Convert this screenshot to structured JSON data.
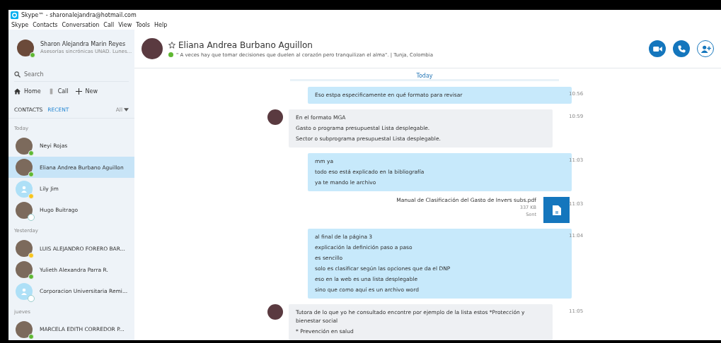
{
  "window": {
    "title": "Skype™ - sharonalejandra@hotmail.com"
  },
  "menu": [
    "Skype",
    "Contacts",
    "Conversation",
    "Call",
    "View",
    "Tools",
    "Help"
  ],
  "profile": {
    "name": "Sharon Alejandra Marin Reyes",
    "mood": "Asesorías sincrónicas UNAD. Lunes...",
    "color": "#5fb832"
  },
  "search": {
    "placeholder": "Search"
  },
  "nav": [
    {
      "label": "Home",
      "kind": "home"
    },
    {
      "label": "Call",
      "kind": "call"
    },
    {
      "label": "New",
      "kind": "new"
    }
  ],
  "list_tabs": [
    {
      "label": "CONTACTS",
      "selected": false
    },
    {
      "label": "RECENT",
      "selected": true
    }
  ],
  "filter": "All",
  "groups": [
    {
      "label": "Today",
      "contacts": [
        {
          "name": "Neyi Rojas",
          "color": "#5fb832",
          "selected": false,
          "photo": true
        },
        {
          "name": "Eliana Andrea Burbano Aguillon",
          "color": "#5fb832",
          "selected": true,
          "photo": true
        },
        {
          "name": "Lily Jim",
          "color": "#f8c51c",
          "selected": false,
          "photo": false
        },
        {
          "name": "Hugo Buitrago",
          "color": "#ffffff",
          "selected": false,
          "photo": true
        }
      ]
    },
    {
      "label": "Yesterday",
      "contacts": [
        {
          "name": "LUIS ALEJANDRO FORERO BAR...",
          "color": "#f8c51c",
          "selected": false,
          "photo": true
        },
        {
          "name": "Yulieth Alexandra Parra R.",
          "color": "#5fb832",
          "selected": false,
          "photo": true
        },
        {
          "name": "Corporacion Universitaria Remi...",
          "color": "#ffffff",
          "selected": false,
          "photo": false
        }
      ]
    },
    {
      "label": "jueves",
      "contacts": [
        {
          "name": "MARCELA EDITH CORREDOR P...",
          "color": "#5fb832",
          "selected": false,
          "photo": true
        }
      ]
    }
  ],
  "conversation": {
    "name": "Eliana Andrea Burbano Aguillon",
    "favorite": false,
    "color": "#5fb832",
    "mood": "\" A veces hay que tomar decisiones que duelen al corazón pero tranquilizan el alma\". | Tunja, Colombia"
  },
  "day_separator": "Today",
  "messages": [
    {
      "kind": "sent",
      "lines": [
        "Eso estpa especificamente en qué formato para revisar"
      ],
      "time": "10:56"
    },
    {
      "kind": "received",
      "lines": [
        "En el formato MGA",
        "Gasto o programa presupuestal Lista desplegable.",
        "Sector o subprograma presupuestal Lista desplegable."
      ],
      "time": "10:59"
    },
    {
      "kind": "sent",
      "lines": [
        "mm ya",
        "todo eso está explicado en la bibliografía",
        "ya te mando le archivo"
      ],
      "time": "11:03"
    },
    {
      "kind": "file",
      "lines": [
        "Manual de Clasificación del Gasto de Invers subs.pdf",
        "337 KB",
        "Sent"
      ],
      "time": "11:03"
    },
    {
      "kind": "sent",
      "lines": [
        "al final de la página 3",
        "explicación la definición paso a paso",
        "es sencillo",
        "solo es clasificar según las opciones que da el DNP",
        "eso en la web es una lista desplegable",
        "sino que como aquí es un archivo word"
      ],
      "time": "11:04"
    },
    {
      "kind": "received",
      "lines": [
        "Tutora de lo que yo he consultado encontre por ejemplo de la lista estos *Protección y bienestar social",
        "* Prevención en salud"
      ],
      "time": "11:05"
    }
  ]
}
